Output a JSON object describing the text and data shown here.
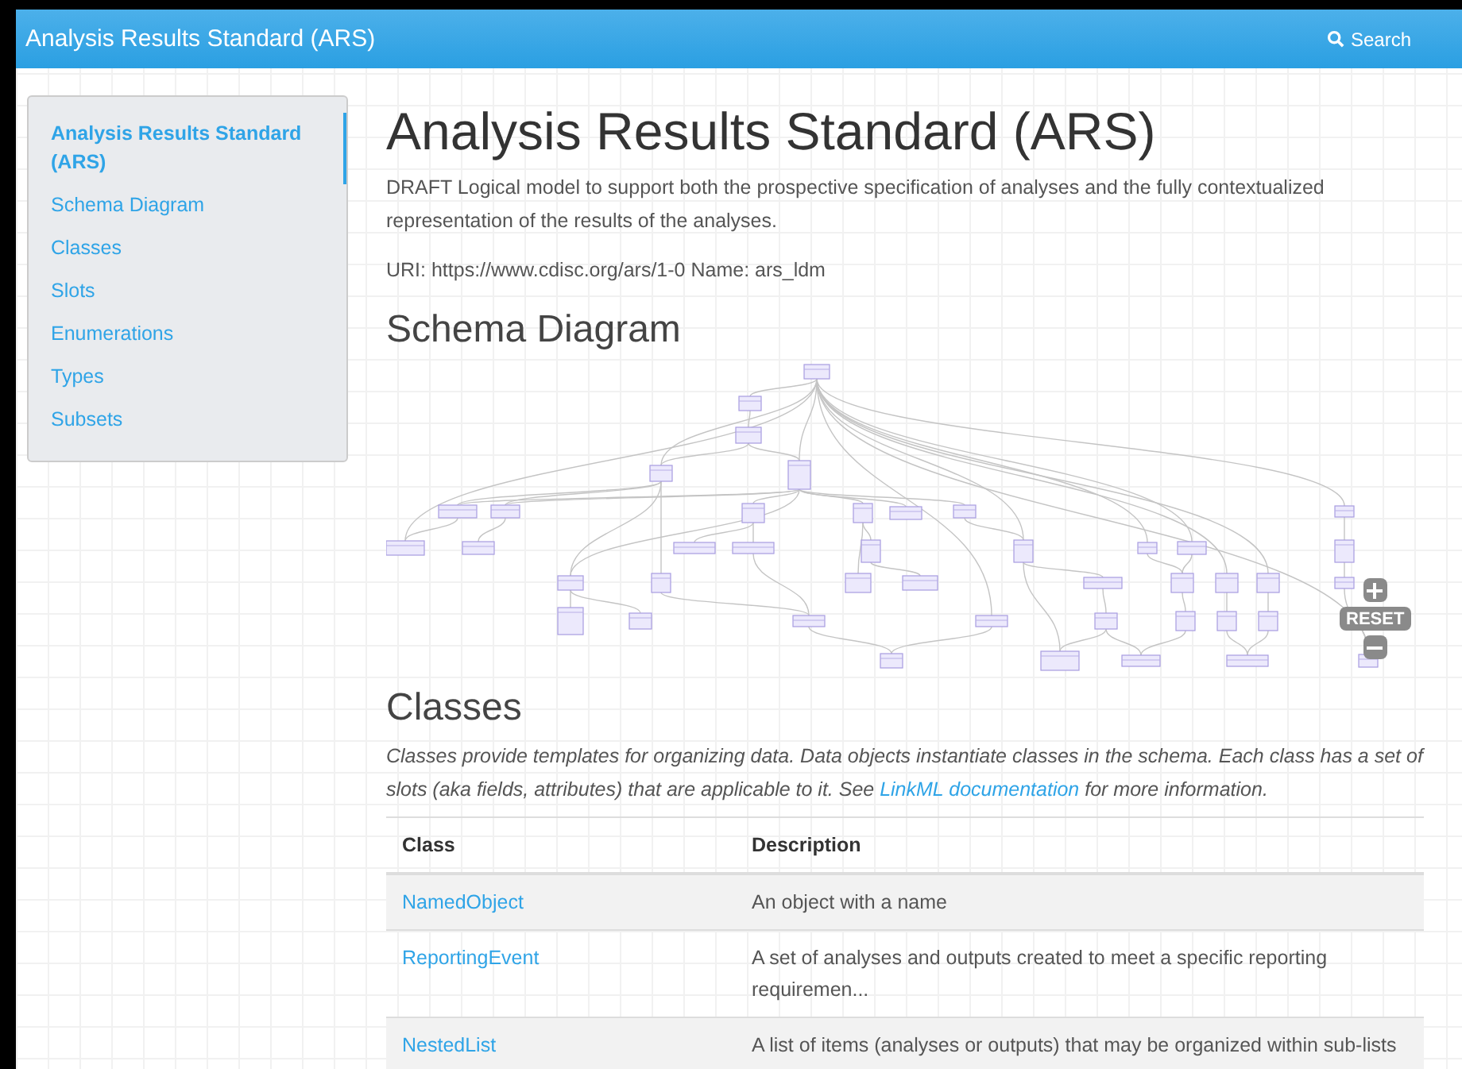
{
  "navbar": {
    "title": "Analysis Results Standard (ARS)",
    "search": "Search"
  },
  "sidebar": {
    "items": [
      {
        "label": "Analysis Results Standard (ARS)",
        "selected": true
      },
      {
        "label": "Schema Diagram",
        "selected": false
      },
      {
        "label": "Classes",
        "selected": false
      },
      {
        "label": "Slots",
        "selected": false
      },
      {
        "label": "Enumerations",
        "selected": false
      },
      {
        "label": "Types",
        "selected": false
      },
      {
        "label": "Subsets",
        "selected": false
      }
    ]
  },
  "header": {
    "title": "Analysis Results Standard (ARS)",
    "description": "DRAFT Logical model to support both the prospective specification of analyses and the fully contextualized representation of the results of the analyses.",
    "uri": "URI: https://www.cdisc.org/ars/1-0 Name: ars_ldm"
  },
  "schema_diagram": {
    "heading": "Schema Diagram",
    "reset": "RESET"
  },
  "classes": {
    "heading": "Classes",
    "intro_before": "Classes provide templates for organizing data. Data objects instantiate classes in the schema. Each class has a set of slots (aka fields, attributes) that are applicable to it. See ",
    "link": "LinkML documentation",
    "intro_after": " for more information.",
    "columns": [
      "Class",
      "Description"
    ],
    "rows": [
      {
        "name": "NamedObject",
        "description": "An object with a name"
      },
      {
        "name": "ReportingEvent",
        "description": "A set of analyses and outputs created to meet a specific reporting requiremen..."
      },
      {
        "name": "NestedList",
        "description": "A list of items (analyses or outputs) that may be organized within sub-lists"
      }
    ]
  }
}
